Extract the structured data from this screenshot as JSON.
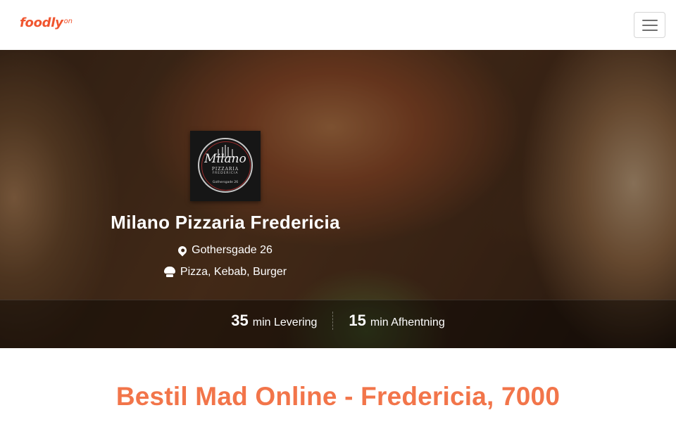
{
  "header": {
    "brand": "foodly",
    "brand_suffix": "on",
    "menu_icon": "hamburger-menu-icon"
  },
  "restaurant": {
    "logo": {
      "name": "Milano",
      "subtitle": "PIZZARIA",
      "subtitle2": "FREDERICIA",
      "address": "Gothersgade 26"
    },
    "name": "Milano Pizzaria Fredericia",
    "address": "Gothersgade 26",
    "address_icon": "map-marker-icon",
    "categories": "Pizza, Kebab, Burger",
    "categories_icon": "chef-hat-icon"
  },
  "times": {
    "delivery": {
      "value": "35",
      "label": "min Levering"
    },
    "pickup": {
      "value": "15",
      "label": "min Afhentning"
    }
  },
  "page": {
    "heading": "Bestil Mad Online - Fredericia, 7000"
  },
  "colors": {
    "brand": "#f0552f",
    "heading": "#f2754a"
  }
}
